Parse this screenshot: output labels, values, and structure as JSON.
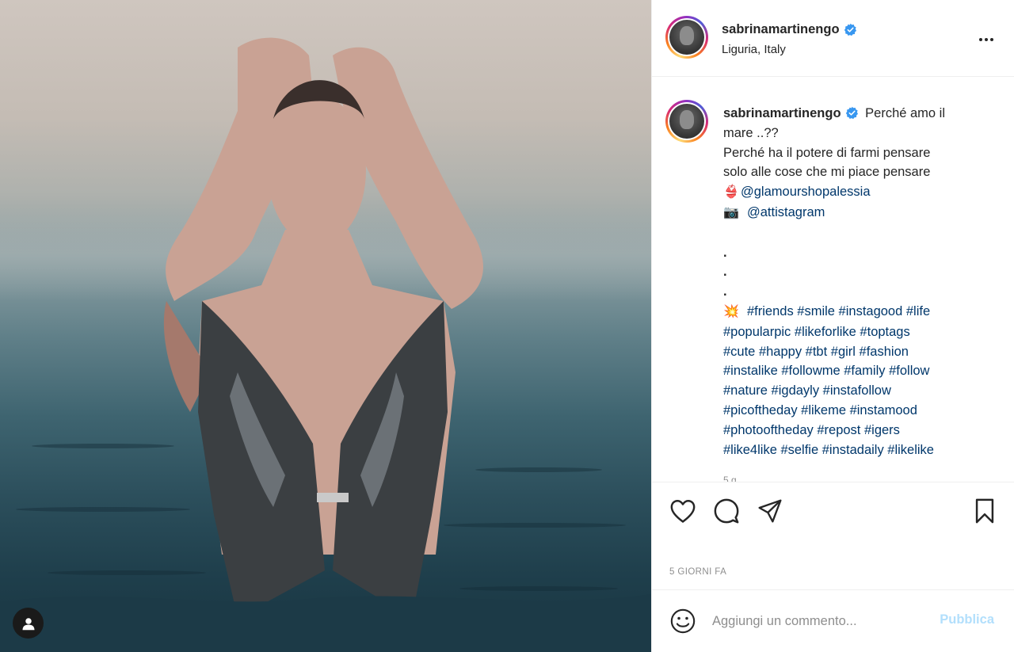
{
  "post": {
    "username": "sabrinamartinengo",
    "location": "Liguria, Italy",
    "timestamp": "5 GIORNI FA"
  },
  "caption": {
    "username": "sabrinamartinengo",
    "line1_text": "Perché amo il",
    "line2": "mare ..??",
    "line3": "Perché ha il potere di farmi pensare",
    "line4": "solo alle cose che mi piace pensare",
    "mention1_emoji": "👙",
    "mention1": "@glamourshopalessia",
    "mention2_emoji": "📷",
    "mention2": "@attistagram",
    "dots": [
      ".",
      ".",
      "."
    ],
    "tags_emoji": "💥",
    "tag_lines": [
      "#friends #smile #instagood #life",
      "#popularpic #likeforlike #toptags",
      "#cute #happy #tbt #girl #fashion",
      "#instalike #followme #family #follow",
      "#nature #igdayly #instafollow",
      "#picoftheday #likeme #instamood",
      "#photooftheday #repost #igers",
      "#like4like #selfie #instadaily #likelike"
    ],
    "overflow_time": "5 g"
  },
  "comment_box": {
    "placeholder": "Aggiungi un commento...",
    "publish_label": "Pubblica"
  },
  "icons": {
    "verified": "verified-badge-icon",
    "more": "more-options-icon",
    "like": "heart-icon",
    "comment": "comment-icon",
    "share": "paper-plane-icon",
    "save": "bookmark-icon",
    "emoji": "smiley-icon",
    "user_tag": "user-icon"
  },
  "colors": {
    "verified_blue": "#3897f0",
    "link": "#00376b",
    "publish_disabled": "#b2dffc",
    "meta_gray": "#8e8e8e"
  }
}
